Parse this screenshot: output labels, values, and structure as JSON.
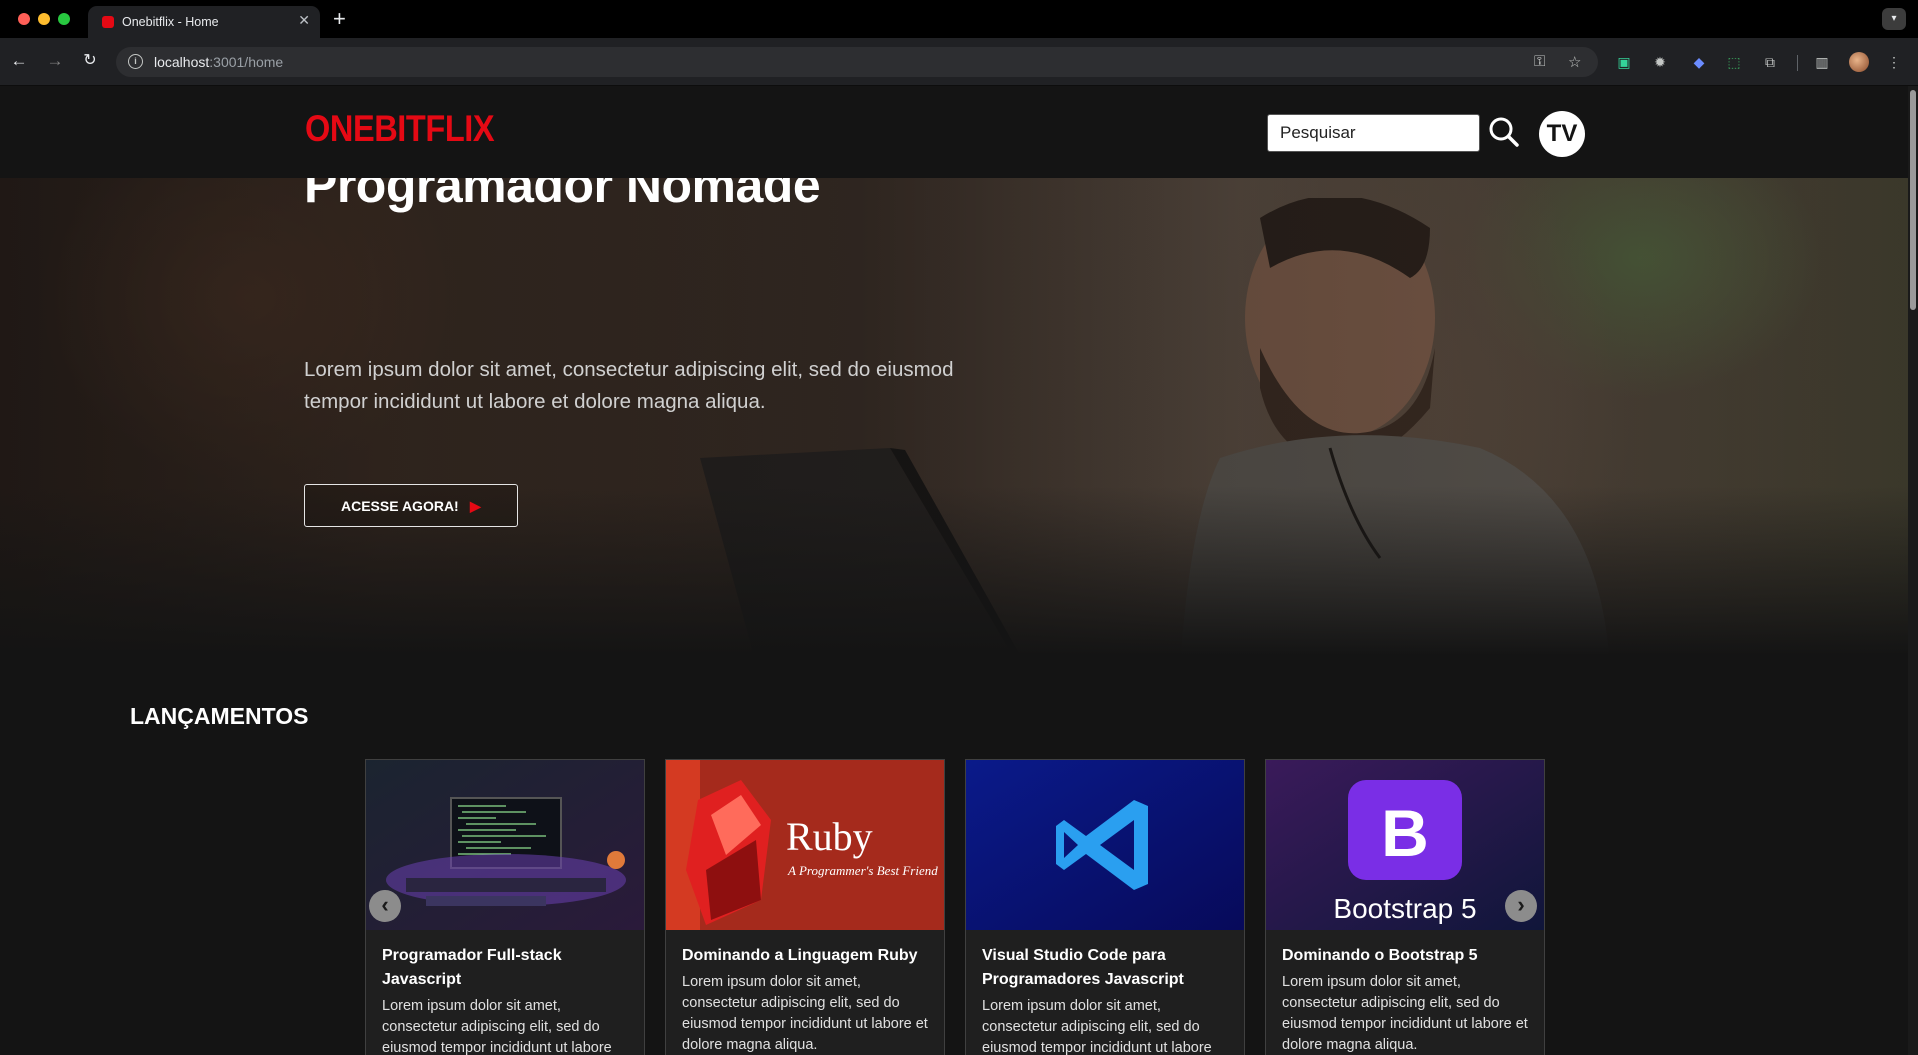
{
  "browser": {
    "tab_title": "Onebitflix - Home",
    "url_host": "localhost",
    "url_path": ":3001/home"
  },
  "site": {
    "logo": "ONEBITFLIX",
    "search_placeholder": "Pesquisar",
    "avatar_initials": "TV",
    "brand_color": "#e50914"
  },
  "hero": {
    "title": "Programador Nômade",
    "description": "Lorem ipsum dolor sit amet, consectetur adipiscing elit, sed do eiusmod tempor incididunt ut labore et dolore magna aliqua.",
    "cta_label": "ACESSE AGORA!"
  },
  "releases": {
    "title": "LANÇAMENTOS",
    "cards": [
      {
        "title": "Programador Full-stack Javascript",
        "description": "Lorem ipsum dolor sit amet, consectetur adipiscing elit, sed do eiusmod tempor incididunt ut labore"
      },
      {
        "title": "Dominando a Linguagem Ruby",
        "description": "Lorem ipsum dolor sit amet, consectetur adipiscing elit, sed do eiusmod tempor incididunt ut labore et dolore magna aliqua.",
        "thumb_title": "Ruby",
        "thumb_subtitle": "A Programmer's Best Friend"
      },
      {
        "title": "Visual Studio Code para Programadores Javascript",
        "description": "Lorem ipsum dolor sit amet, consectetur adipiscing elit, sed do eiusmod tempor incididunt ut labore"
      },
      {
        "title": "Dominando o Bootstrap 5",
        "description": "Lorem ipsum dolor sit amet, consectetur adipiscing elit, sed do eiusmod tempor incididunt ut labore et dolore magna aliqua.",
        "thumb_letter": "B",
        "thumb_title": "Bootstrap 5"
      }
    ]
  }
}
